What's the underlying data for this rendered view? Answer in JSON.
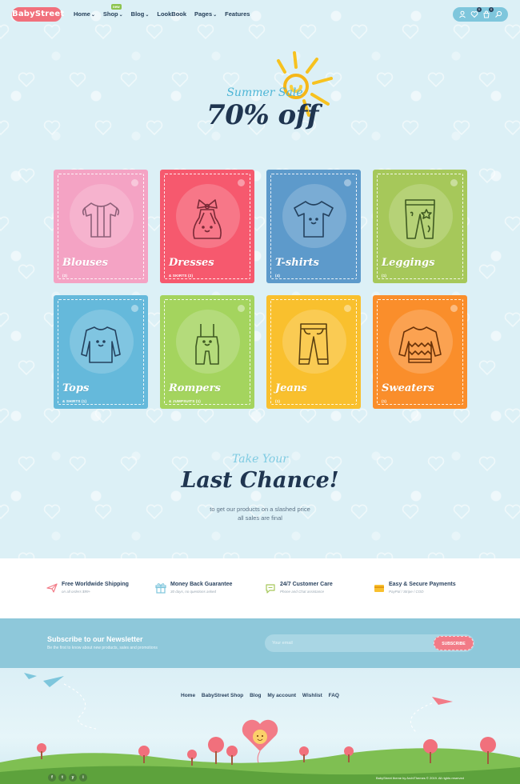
{
  "header": {
    "logo": "BabyStreet",
    "nav": [
      {
        "label": "Home",
        "dropdown": true
      },
      {
        "label": "Shop",
        "dropdown": true,
        "badge": "new"
      },
      {
        "label": "Blog",
        "dropdown": true
      },
      {
        "label": "LookBook",
        "dropdown": false
      },
      {
        "label": "Pages",
        "dropdown": true
      },
      {
        "label": "Features",
        "dropdown": false
      }
    ],
    "icons": [
      "user-icon",
      "heart-icon",
      "cart-icon",
      "search-icon"
    ],
    "wishlist_count": "0",
    "cart_count": "0"
  },
  "sale": {
    "line1": "Summer Sale",
    "line2": "70% off"
  },
  "categories": [
    {
      "name": "Blouses",
      "sub": "(3)",
      "color": "#f4a3c4",
      "icon": "blouse-icon"
    },
    {
      "name": "Dresses",
      "sub": "& SKIRTS (2)",
      "color": "#f6596e",
      "icon": "dress-icon"
    },
    {
      "name": "T-shirts",
      "sub": "(4)",
      "color": "#5d9acb",
      "icon": "tshirt-icon"
    },
    {
      "name": "Leggings",
      "sub": "(1)",
      "color": "#a6c85a",
      "icon": "leggings-icon"
    },
    {
      "name": "Tops",
      "sub": "& SHIRTS (1)",
      "color": "#65b9db",
      "icon": "top-icon"
    },
    {
      "name": "Rompers",
      "sub": "& JUMPSUITS (1)",
      "color": "#a4d45e",
      "icon": "romper-icon"
    },
    {
      "name": "Jeans",
      "sub": "(1)",
      "color": "#f9c02e",
      "icon": "jeans-icon"
    },
    {
      "name": "Sweaters",
      "sub": "(1)",
      "color": "#fa8e2b",
      "icon": "sweater-icon"
    }
  ],
  "last_chance": {
    "kicker": "Take Your",
    "title": "Last Chance!",
    "line1": "to get our products on a slashed price",
    "line2": "all sales are final"
  },
  "features": [
    {
      "title": "Free Worldwide Shipping",
      "sub": "on all orders $99+",
      "icon": "plane-icon",
      "color": "#f27b87"
    },
    {
      "title": "Money Back Guarantee",
      "sub": "30 days, no questions asked",
      "icon": "gift-icon",
      "color": "#7ec6dc"
    },
    {
      "title": "24/7 Customer Care",
      "sub": "Phone and Chat assistance",
      "icon": "chat-icon",
      "color": "#a6c85a"
    },
    {
      "title": "Easy & Secure Payments",
      "sub": "PayPal / Stripe / COD",
      "icon": "card-icon",
      "color": "#f9c02e"
    }
  ],
  "newsletter": {
    "title": "Subscribe to our Newsletter",
    "sub": "Be the first to know about new products, sales and promotions",
    "placeholder": "Your email",
    "button": "SUBSCRIBE"
  },
  "footer": {
    "nav": [
      "Home",
      "BabyStreet Shop",
      "Blog",
      "My account",
      "Wishlist",
      "FAQ"
    ],
    "socials": [
      "f",
      "t",
      "y",
      "i"
    ],
    "copyright": "BabyStreet theme by ArchiThemes © 2019. All rights reserved"
  }
}
